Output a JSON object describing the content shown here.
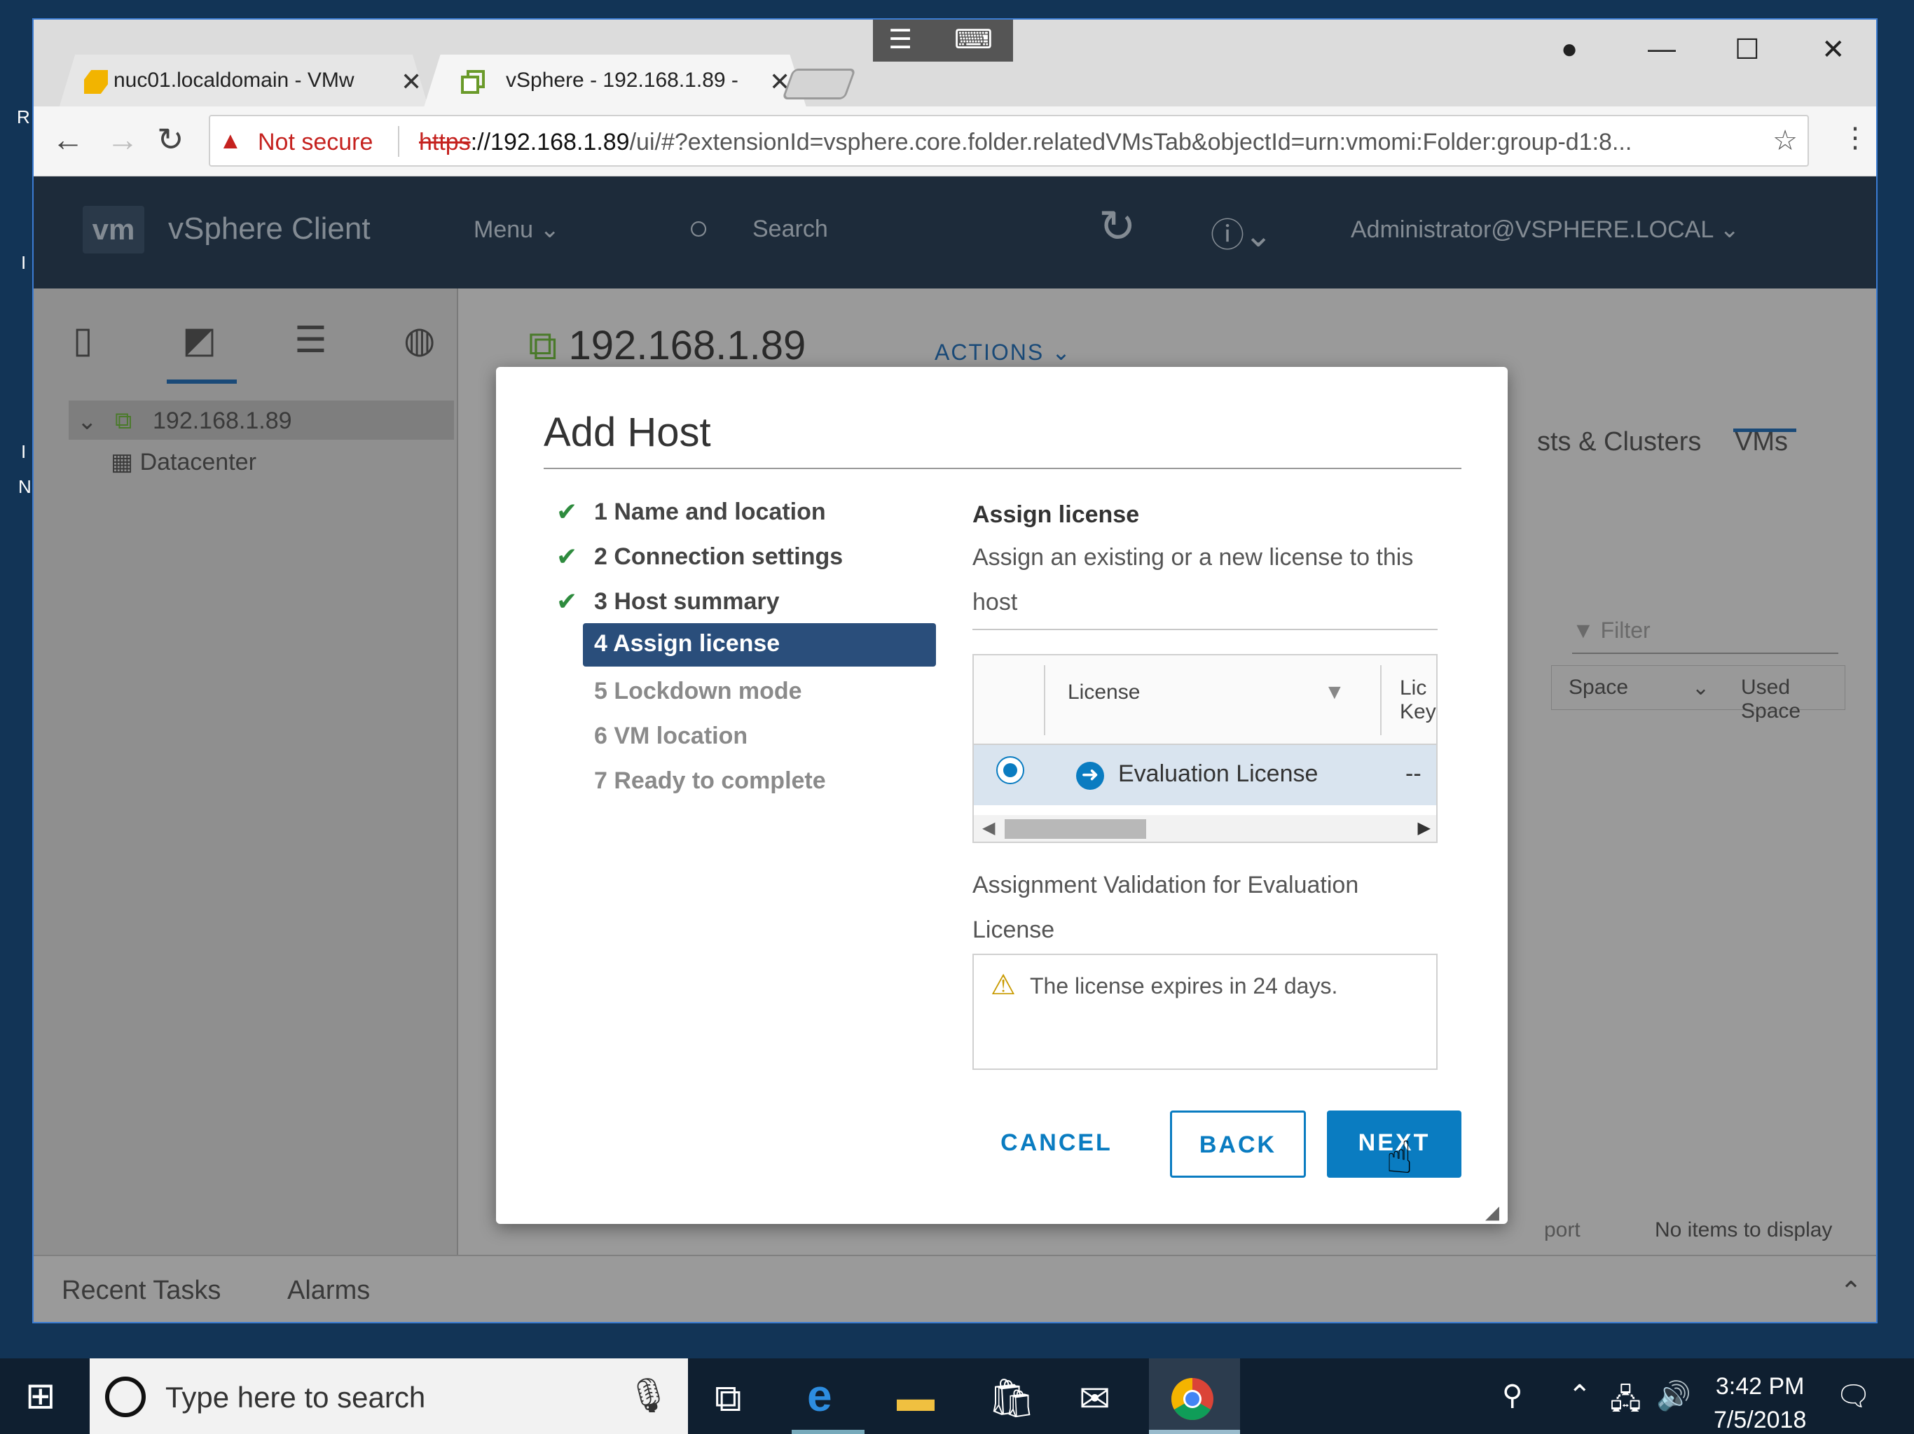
{
  "browser": {
    "tabs": [
      {
        "label": "nuc01.localdomain - VMw"
      },
      {
        "label": "vSphere - 192.168.1.89 - "
      }
    ],
    "address": {
      "not_secure": "Not secure",
      "scheme": "https",
      "host": "://192.168.1.89",
      "path": "/ui/#?extensionId=vsphere.core.folder.relatedVMsTab&objectId=urn:vmomi:Folder:group-d1:8..."
    }
  },
  "vsphere": {
    "logo": "vm",
    "app_title": "vSphere Client",
    "menu_label": "Menu",
    "search_label": "Search",
    "user_label": "Administrator@VSPHERE.LOCAL"
  },
  "left_pane": {
    "tree": [
      {
        "label": "192.168.1.89"
      },
      {
        "label": "Datacenter"
      }
    ]
  },
  "content": {
    "title": "192.168.1.89",
    "actions_label": "ACTIONS",
    "tabs": [
      "sts & Clusters",
      "VMs"
    ],
    "filter_placeholder": "Filter",
    "columns": [
      "Space",
      "Used Space"
    ],
    "footer_left": "port",
    "footer_right": "No items to display"
  },
  "bottom": {
    "recent_tasks": "Recent Tasks",
    "alarms": "Alarms"
  },
  "modal": {
    "title": "Add Host",
    "steps": [
      {
        "label": "1 Name and location",
        "status": "done"
      },
      {
        "label": "2 Connection settings",
        "status": "done"
      },
      {
        "label": "3 Host summary",
        "status": "done"
      },
      {
        "label": "4 Assign license",
        "status": "active"
      },
      {
        "label": "5 Lockdown mode",
        "status": "todo"
      },
      {
        "label": "6 VM location",
        "status": "todo"
      },
      {
        "label": "7 Ready to complete",
        "status": "todo"
      }
    ],
    "section_title": "Assign license",
    "section_desc": "Assign an existing or a new license to this host",
    "grid": {
      "col_license": "License",
      "col_key_1": "Lic",
      "col_key_2": "Key",
      "row_name": "Evaluation License",
      "row_key": "--"
    },
    "validation_label": "Assignment Validation for Evaluation License",
    "validation_message": "The license expires in 24 days.",
    "buttons": {
      "cancel": "CANCEL",
      "back": "BACK",
      "next": "NEXT"
    }
  },
  "taskbar": {
    "search_placeholder": "Type here to search",
    "time": "3:42 PM",
    "date": "7/5/2018"
  },
  "colors": {
    "accent": "#0a7cc1",
    "header_bg": "#1d2b3a",
    "active_step": "#2a4e7b",
    "check_green": "#2e8b3e"
  }
}
